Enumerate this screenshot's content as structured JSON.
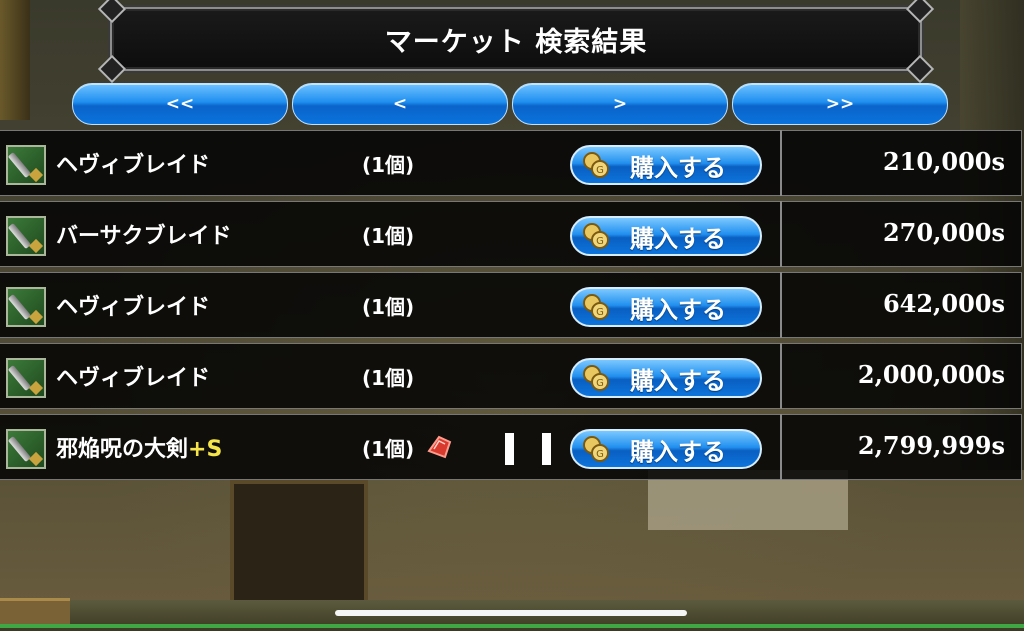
{
  "header": {
    "title": "マーケット 検索結果"
  },
  "pagination": {
    "first": "<<",
    "prev": "<",
    "next": ">",
    "last": ">>"
  },
  "listings": [
    {
      "name": "ヘヴィブレイド",
      "enhance": "",
      "qty": "(1個)",
      "buy": "購入する",
      "price": "210,000s"
    },
    {
      "name": "バーサクブレイド",
      "enhance": "",
      "qty": "(1個)",
      "buy": "購入する",
      "price": "270,000s"
    },
    {
      "name": "ヘヴィブレイド",
      "enhance": "",
      "qty": "(1個)",
      "buy": "購入する",
      "price": "642,000s"
    },
    {
      "name": "ヘヴィブレイド",
      "enhance": "",
      "qty": "(1個)",
      "buy": "購入する",
      "price": "2,000,000s"
    },
    {
      "name": "邪焔呪の大剣",
      "enhance": "+S",
      "qty": "(1個)",
      "buy": "購入する",
      "price": "2,799,999s"
    }
  ],
  "icons": {
    "item": "sword-icon",
    "coin": "coin-icon",
    "gem": "red-gem-icon"
  },
  "colors": {
    "button_blue": "#1f8ff0",
    "enhance_yellow": "#f5e44a"
  }
}
